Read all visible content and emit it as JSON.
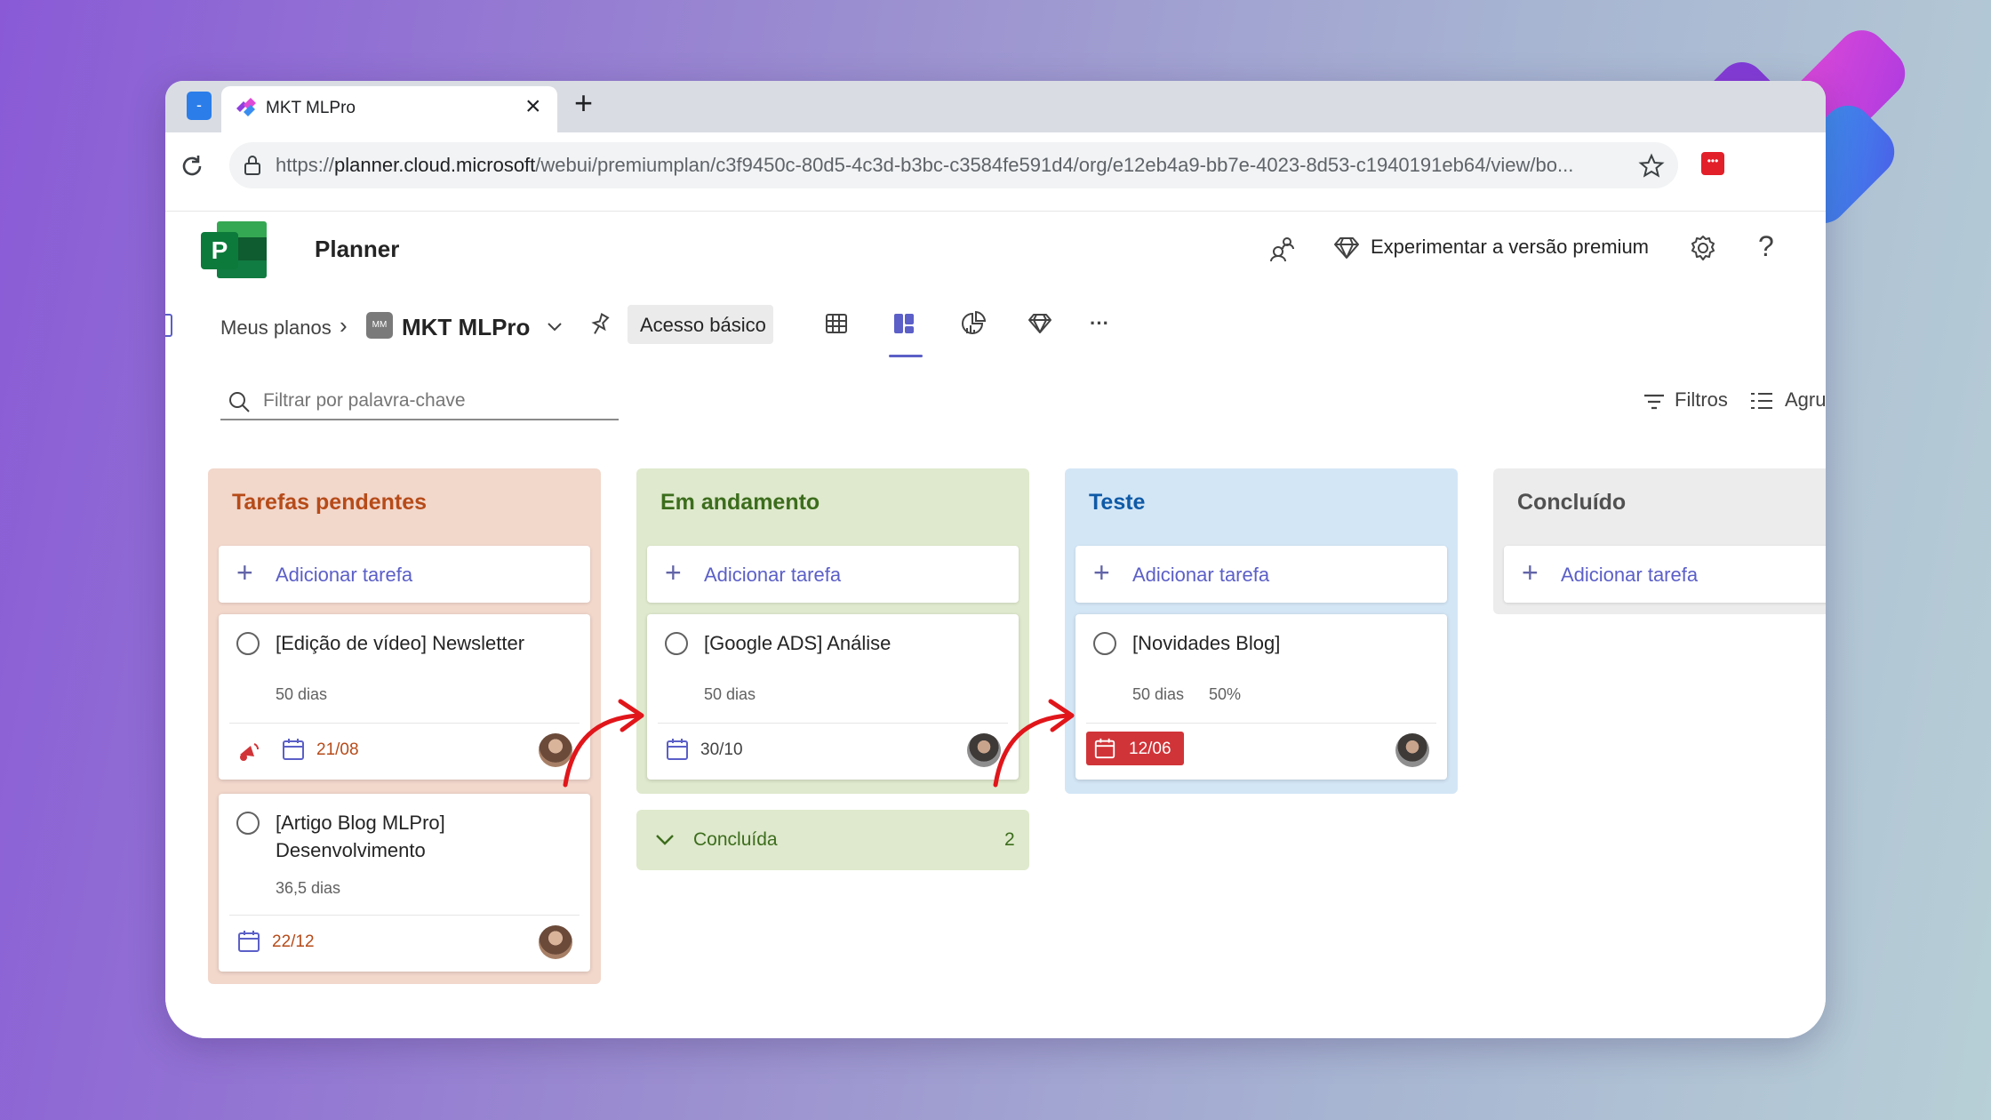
{
  "browser": {
    "tab_title": "MKT MLPro",
    "close_glyph": "×",
    "new_tab_glyph": "+",
    "url_prefix": "https://",
    "url_host": "planner.cloud.microsoft",
    "url_path": "/webui/premiumplan/c3f9450c-80d5-4c3d-b3bc-c3584fe591d4/org/e12eb4a9-bb7e-4023-8d53-c1940191eb64/view/bo..."
  },
  "app": {
    "name": "Planner",
    "premium_label": "Experimentar a versão premium",
    "help_glyph": "?"
  },
  "planbar": {
    "breadcrumb_root": "Meus planos",
    "plan_name": "MKT MLPro",
    "plan_badge": "MM",
    "access_label": "Acesso básico",
    "more_glyph": "···"
  },
  "filters": {
    "search_placeholder": "Filtrar por palavra-chave",
    "filter_label": "Filtros",
    "group_label": "Agru"
  },
  "board": {
    "columns": [
      {
        "title": "Tarefas pendentes",
        "title_color": "#b64b19",
        "bg": "#f2d7cb",
        "add_label": "Adicionar tarefa",
        "cards": [
          {
            "title": "[Edição de vídeo] Newsletter",
            "meta": "50 dias",
            "date": "21/08"
          },
          {
            "title": "[Artigo Blog MLPro] Desenvolvimento",
            "meta": "36,5 dias",
            "date": "22/12"
          }
        ]
      },
      {
        "title": "Em andamento",
        "title_color": "#3c6d1d",
        "bg": "#dfe9cd",
        "add_label": "Adicionar tarefa",
        "cards": [
          {
            "title": "[Google ADS] Análise",
            "meta": "50 dias",
            "date": "30/10"
          }
        ],
        "completed_label": "Concluída",
        "completed_count": "2"
      },
      {
        "title": "Teste",
        "title_color": "#0f5aa6",
        "bg": "#d3e6f6",
        "add_label": "Adicionar tarefa",
        "cards": [
          {
            "title": "[Novidades Blog]",
            "meta": "50 dias",
            "progress": "50%",
            "date": "12/06",
            "date_bg": "#d13438"
          }
        ]
      },
      {
        "title": "Concluído",
        "title_color": "#505050",
        "bg": "#ececec",
        "add_label": "Adicionar tarefa",
        "cards": []
      }
    ]
  },
  "colors": {
    "accent": "#5b5fc7",
    "planner_green": "#107c41",
    "arrow_red": "#e0161b",
    "overdue_red": "#d13438"
  }
}
